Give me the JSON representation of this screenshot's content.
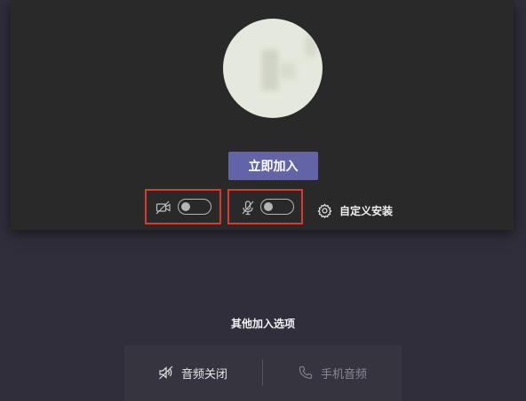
{
  "preview": {
    "join_button_label": "立即加入",
    "custom_setup_label": "自定义安装",
    "video_toggle_on": false,
    "mic_toggle_on": false
  },
  "other_options": {
    "title": "其他加入选项",
    "items": [
      {
        "label": "音频关闭",
        "icon": "speaker-off-icon",
        "enabled": true
      },
      {
        "label": "手机音频",
        "icon": "phone-icon",
        "enabled": false
      }
    ]
  },
  "colors": {
    "accent": "#6264a7",
    "highlight_border": "#d93a2b",
    "card_background": "#292929",
    "page_background": "#302e3a"
  }
}
